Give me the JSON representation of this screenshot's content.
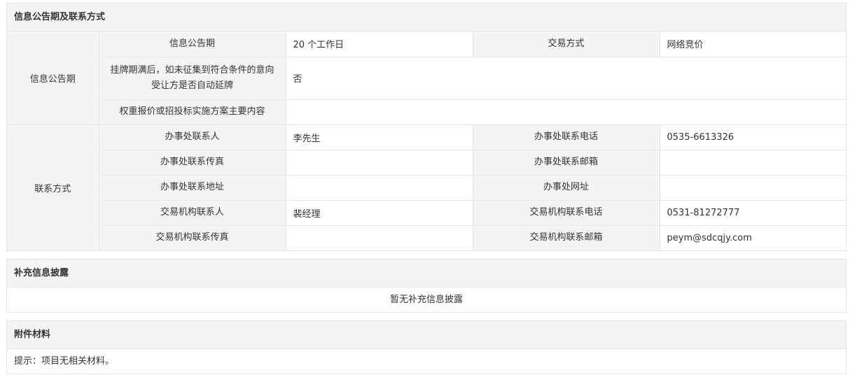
{
  "info_section": {
    "title": "信息公告期及联系方式",
    "group_announce": "信息公告期",
    "group_contact": "联系方式",
    "rows": {
      "announce_period_label": "信息公告期",
      "announce_period_value": "20 个工作日",
      "trade_mode_label": "交易方式",
      "trade_mode_value": "网络竞价",
      "auto_extend_label": "挂牌期满后，如未征集到符合条件的意向受让方是否自动延牌",
      "auto_extend_value": "否",
      "weighted_label": "权重报价或招投标实施方案主要内容",
      "weighted_value": "",
      "office_contact_label": "办事处联系人",
      "office_contact_value": "李先生",
      "office_phone_label": "办事处联系电话",
      "office_phone_value": "0535-6613326",
      "office_fax_label": "办事处联系传真",
      "office_fax_value": "",
      "office_email_label": "办事处联系邮箱",
      "office_email_value": "",
      "office_address_label": "办事处联系地址",
      "office_address_value": "",
      "office_website_label": "办事处网址",
      "office_website_value": "",
      "org_contact_label": "交易机构联系人",
      "org_contact_value": "裴经理",
      "org_phone_label": "交易机构联系电话",
      "org_phone_value": "0531-81272777",
      "org_fax_label": "交易机构联系传真",
      "org_fax_value": "",
      "org_email_label": "交易机构联系邮箱",
      "org_email_value": "peym@sdcqjy.com"
    }
  },
  "supplement_section": {
    "title": "补充信息披露",
    "message": "暂无补充信息披露"
  },
  "attachment_section": {
    "title": "附件材料",
    "message": "提示：项目无相关材料。"
  }
}
